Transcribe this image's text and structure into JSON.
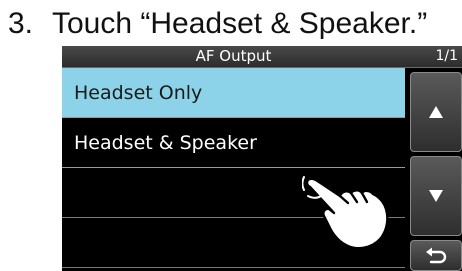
{
  "instruction": {
    "step_number": "3.",
    "text": "Touch “Headset & Speaker.”"
  },
  "screen": {
    "title": "AF Output",
    "page_indicator": "1/1",
    "items": [
      {
        "label": "Headset Only",
        "selected": true
      },
      {
        "label": "Headset & Speaker",
        "selected": false
      },
      {
        "label": "",
        "selected": false
      },
      {
        "label": "",
        "selected": false
      }
    ],
    "buttons": {
      "up_icon": "up-triangle-icon",
      "down_icon": "down-triangle-icon",
      "back_icon": "return-arrow-icon"
    }
  },
  "colors": {
    "selected_bg": "#8cd3ea",
    "screen_bg": "#000000"
  }
}
